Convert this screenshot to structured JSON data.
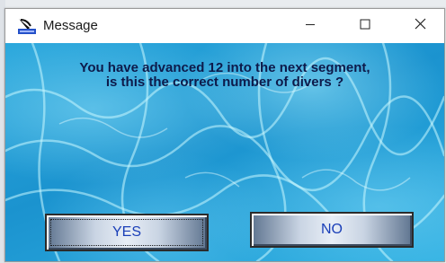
{
  "window": {
    "title": "Message",
    "icon": "diver-app-icon",
    "controls": {
      "minimize_icon": "minimize-icon",
      "maximize_icon": "maximize-icon",
      "close_icon": "close-icon"
    }
  },
  "dialog": {
    "message_line1": "You have advanced 12 into the next segment,",
    "message_line2": "is this the correct number of divers ?",
    "yes_label": "YES",
    "no_label": "NO"
  },
  "colors": {
    "message_text": "#0d1a4a",
    "button_text": "#1a3fb8",
    "water": "#2aa7dc"
  }
}
